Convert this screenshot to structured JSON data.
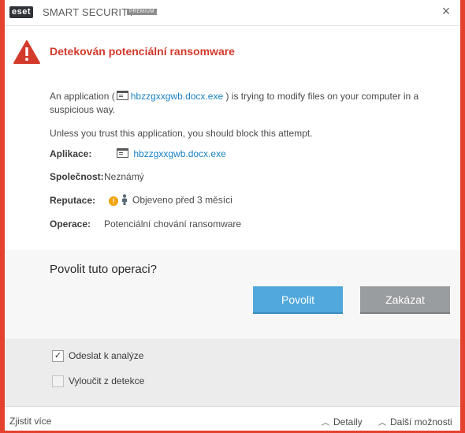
{
  "app": {
    "brand": "eset",
    "product_name": "SMART SECURITY",
    "edition": "PREMIUM",
    "close_glyph": "×"
  },
  "alert": {
    "title": "Detekován potenciální ransomware",
    "desc_prefix": "An application (",
    "desc_file": "hbzzgxxgwb.docx.exe",
    "desc_suffix": ") is trying to modify files on your computer in a suspicious way.",
    "advice": "Unless you trust this application, you should block this attempt."
  },
  "details": {
    "application_label": "Aplikace:",
    "application_value": "hbzzgxxgwb.docx.exe",
    "company_label": "Společnost:",
    "company_value": "Neznámý",
    "reputation_label": "Reputace:",
    "reputation_value": "Objeveno před 3 měsíci",
    "operation_label": "Operace:",
    "operation_value": "Potenciální chování ransomware"
  },
  "prompt": {
    "question": "Povolit tuto operaci?",
    "allow_label": "Povolit",
    "block_label": "Zakázat"
  },
  "options": [
    {
      "label": "Odeslat k analýze",
      "checked": true
    },
    {
      "label": "Vyloučit z detekce",
      "checked": false
    }
  ],
  "footer": {
    "learn_more": "Zjistit více",
    "details": "Detaily",
    "more_options": "Další možnosti"
  },
  "colors": {
    "frame": "#e4412f",
    "title_red": "#d33a2c",
    "link": "#1a82c3",
    "allow_button": "#51a8dc",
    "block_button": "#9a9d9f",
    "warning_badge": "#f0a30a"
  },
  "icons": {
    "warning": "warning-triangle-icon",
    "file": "file-icon",
    "reputation_warning": "exclamation-icon",
    "users": "person-icon",
    "chevron": "chevron-up-icon"
  }
}
